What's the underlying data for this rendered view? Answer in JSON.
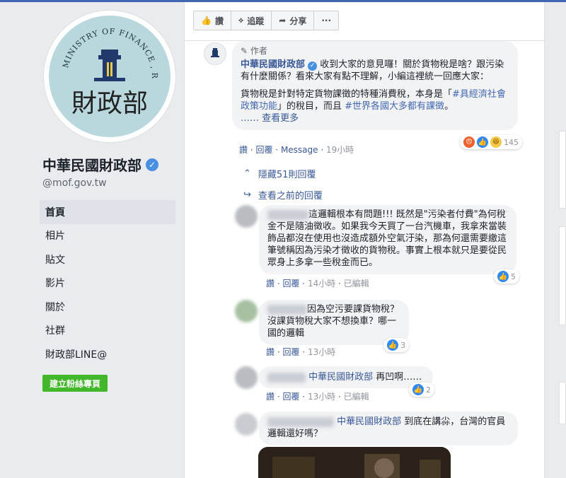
{
  "page": {
    "name": "中華民國財政部",
    "handle": "@mof.gov.tw",
    "logo_text_top": "MINISTRY OF FINANCE , R.O.C.",
    "logo_text_cn": "財政部"
  },
  "nav": [
    {
      "label": "首頁",
      "active": true
    },
    {
      "label": "相片"
    },
    {
      "label": "貼文"
    },
    {
      "label": "影片"
    },
    {
      "label": "關於"
    },
    {
      "label": "社群"
    },
    {
      "label": "財政部LINE@"
    }
  ],
  "create_page_button": "建立粉絲專頁",
  "actions": {
    "like": "讚",
    "follow": "追蹤",
    "share": "分享",
    "more": "···"
  },
  "main_comment": {
    "author_badge": "作者",
    "author": "中華民國財政部",
    "text1": " 收到大家的意見囉！關於貨物稅是啥？跟污染有什麼關係？看來大家有點不理解，小編這裡統一回應大家：",
    "text2a": "貨物稅是針對特定貨物課徵的特種消費稅，本身是「",
    "tag1": "#具經濟社會政策功能",
    "text2b": "」的稅目，而且 ",
    "tag2": "#世界各國大多都有課徵",
    "text2c": "。",
    "more": "…… 查看更多",
    "meta": {
      "like": "讚",
      "reply": "回覆",
      "message": "Message",
      "time": "19小時"
    },
    "reaction_count": "145"
  },
  "hide_replies": "隱藏51則回覆",
  "view_previous": "查看之前的回覆",
  "replies": [
    {
      "text": "這邏輯根本有問題!!! 既然是\"污染者付費\"為何稅金不是隨油徵收。如果我今天買了一台汽機車，我拿來當裝飾品都沒在使用也沒造成額外空氣汙染，那為何還需要繳這筆號稱因為污染才徵收的貨物稅。事實上根本就只是要從民眾身上多拿一些稅金而已。",
      "meta": {
        "like": "讚",
        "reply": "回覆",
        "time": "14小時",
        "edited": "已編輯"
      },
      "reactions": "5"
    },
    {
      "text": "因為空污要課貨物稅？沒課貨物稅大家不想換車？哪一國的邏輯",
      "meta": {
        "like": "讚",
        "reply": "回覆",
        "time": "13小時"
      },
      "reactions": "3"
    },
    {
      "mention": "中華民國財政部",
      "text": " 再凹啊……",
      "meta": {
        "like": "讚",
        "reply": "回覆",
        "time": "13小時",
        "edited": "已編輯"
      },
      "reactions": "2"
    },
    {
      "mention": "中華民國財政部",
      "text": " 到底在講尛，台灣的官員邏輯還好嗎？"
    }
  ],
  "colors": {
    "link": "#385898",
    "fb_blue": "#4267b2",
    "green": "#42b72a",
    "verified": "#4a90e2"
  }
}
